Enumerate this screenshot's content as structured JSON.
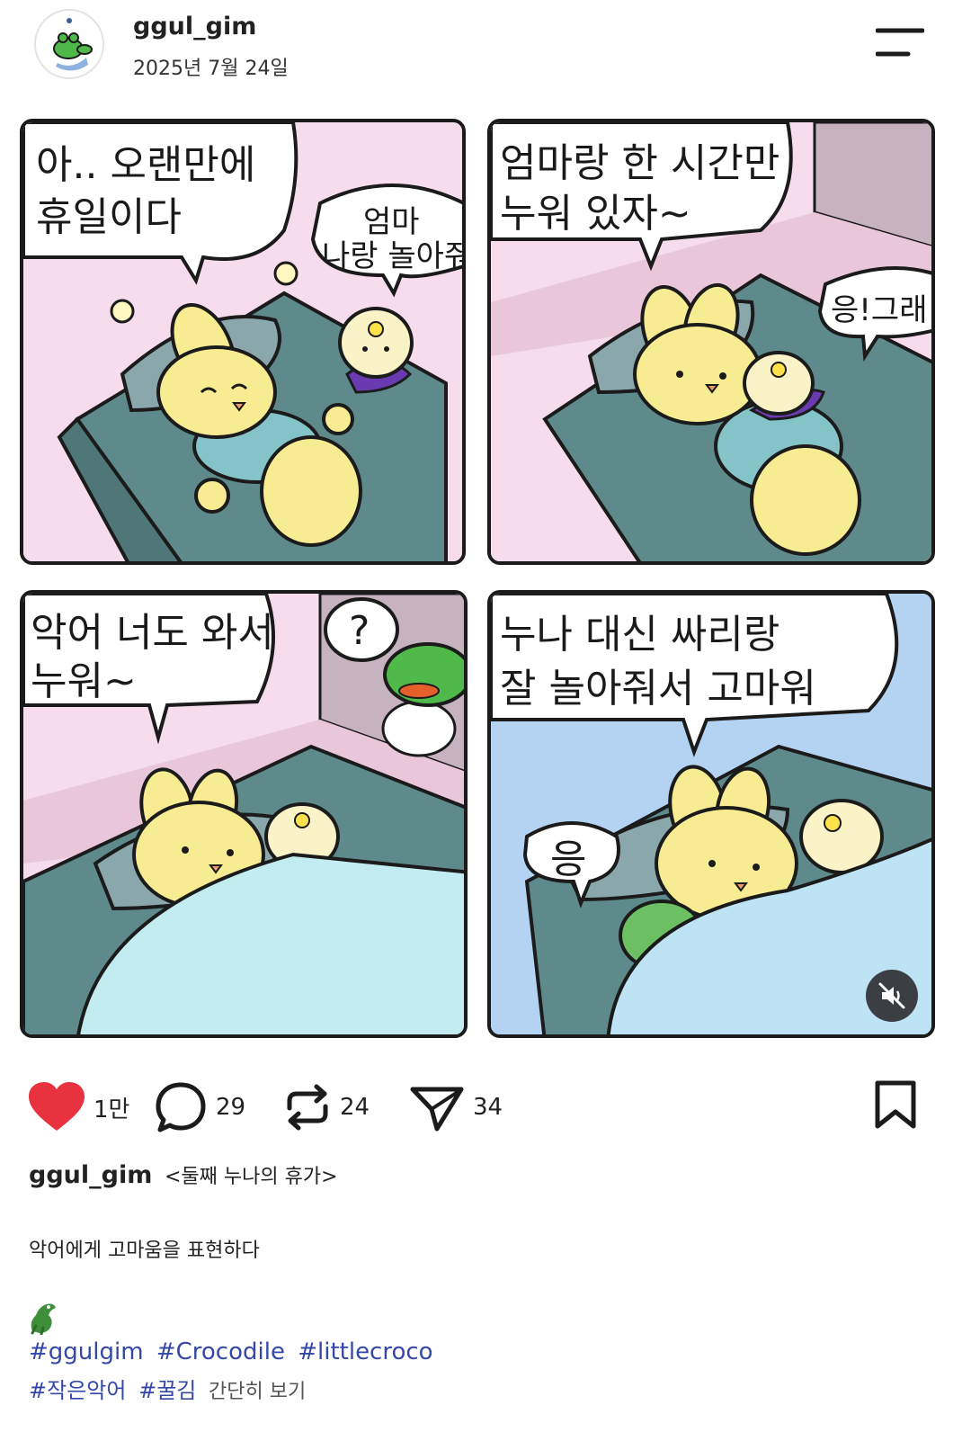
{
  "post": {
    "username": "ggul_gim",
    "date": "2025년 7월 24일"
  },
  "icons": {
    "menu": "menu-icon",
    "like": "heart-icon",
    "comment": "comment-icon",
    "repost": "repost-icon",
    "share": "send-icon",
    "bookmark": "bookmark-icon",
    "mute": "mute-icon"
  },
  "comic": {
    "panel1": {
      "bubble1": [
        "아.. 오랜만에",
        "휴일이다"
      ],
      "bubble2": [
        "엄마",
        "나랑 놀아줘"
      ]
    },
    "panel2": {
      "bubble1": [
        "엄마랑 한 시간만",
        "누워 있자~"
      ],
      "bubble2": [
        "응!그래"
      ]
    },
    "panel3": {
      "bubble1": [
        "악어 너도 와서",
        "누워~"
      ],
      "bubble2": [
        "?"
      ]
    },
    "panel4": {
      "bubble1": [
        "누나 대신  싸리랑",
        "잘 놀아줘서 고마워"
      ],
      "bubble2": [
        "응"
      ]
    }
  },
  "actions": {
    "likes": "1만",
    "comments": "29",
    "reposts": "24",
    "shares": "34"
  },
  "caption": {
    "username": "ggul_gim",
    "title": "<둘째 누나의 휴가>",
    "body": "악어에게 고마움을 표현하다",
    "emoji": "🐊",
    "tags_line1": [
      "#ggulgim",
      "#Crocodile",
      "#littlecroco"
    ],
    "tags_line2": [
      "#작은악어",
      "#꿀김"
    ],
    "more_label": "간단히 보기"
  },
  "colors": {
    "heart": "#e8323f",
    "hashtag": "#3548a8",
    "wall_pink": "#f6dcec",
    "bed_teal": "#5e8a8b",
    "bunny_yellow": "#f7ec92",
    "blanket_blue": "#c2ecef",
    "dream_blue": "#a9cdf2"
  }
}
